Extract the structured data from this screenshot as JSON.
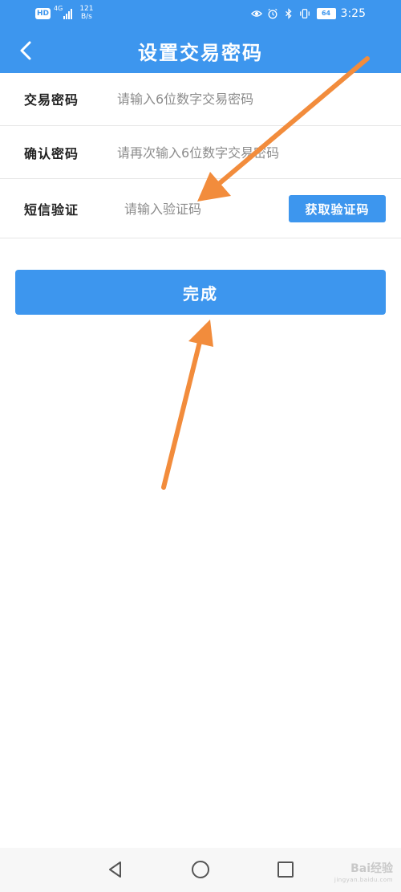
{
  "status_bar": {
    "hd": "HD",
    "network": "4G",
    "speed_value": "121",
    "speed_unit": "B/s",
    "battery": "64",
    "time": "3:25",
    "icons": [
      "eye-icon",
      "alarm-icon",
      "bluetooth-icon",
      "vibrate-icon"
    ]
  },
  "header": {
    "title": "设置交易密码",
    "back_icon": "chevron-left-icon"
  },
  "form": {
    "password": {
      "label": "交易密码",
      "placeholder": "请输入6位数字交易密码",
      "value": ""
    },
    "confirm": {
      "label": "确认密码",
      "placeholder": "请再次输入6位数字交易密码",
      "value": ""
    },
    "sms": {
      "label": "短信验证",
      "placeholder": "请输入验证码",
      "value": "",
      "button": "获取验证码"
    }
  },
  "actions": {
    "done": "完成"
  },
  "annotations": {
    "arrow_color": "#f28c3c",
    "count": 2
  },
  "nav_bar": {
    "icons": [
      "back-triangle-icon",
      "home-circle-icon",
      "recents-square-icon"
    ]
  },
  "watermark": {
    "brand": "Bai",
    "brand_suffix": "经验",
    "url": "jingyan.baidu.com"
  },
  "colors": {
    "primary": "#3d96ee",
    "background": "#ffffff",
    "divider": "#e6e6e6"
  }
}
